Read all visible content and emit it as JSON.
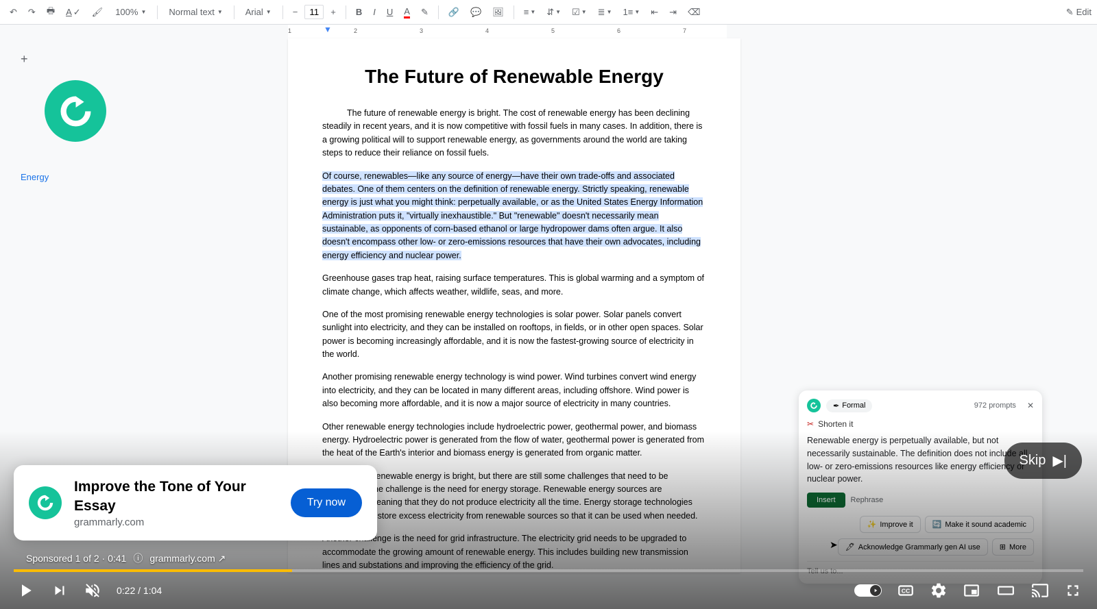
{
  "toolbar": {
    "zoom": "100%",
    "style": "Normal text",
    "font": "Arial",
    "size": "11",
    "edit": "Edit"
  },
  "ruler": {
    "marks": [
      "1",
      "2",
      "3",
      "4",
      "5",
      "6",
      "7"
    ]
  },
  "sidebar": {
    "outline_item": "Energy"
  },
  "doc": {
    "title": "The Future of Renewable Energy",
    "p1": "The future of renewable energy is bright. The cost of renewable energy has been declining steadily in recent years, and it is now competitive with fossil fuels in many cases. In addition, there is a growing political will to support renewable energy, as governments around the world are taking steps to reduce their reliance on fossil fuels.",
    "p2": "Of course, renewables—like any source of energy—have their own trade-offs and associated debates. One of them centers on the definition of renewable energy. Strictly speaking, renewable energy is just what you might think: perpetually available, or as the United States Energy Information Administration puts it, \"virtually inexhaustible.\" But \"renewable\" doesn't necessarily mean sustainable, as opponents of corn-based ethanol or large hydropower dams often argue. It also doesn't encompass other low- or zero-emissions resources that have their own advocates, including energy efficiency and nuclear power.",
    "p3": "Greenhouse gases trap heat, raising surface temperatures. This is global warming and a symptom of climate change, which affects weather, wildlife, seas, and more.",
    "p4": "One of the most promising renewable energy technologies is solar power. Solar panels convert sunlight into electricity, and they can be installed on rooftops, in fields, or in other open spaces. Solar power is becoming increasingly affordable, and it is now the fastest-growing source of electricity in the world.",
    "p5": "Another promising renewable energy technology is wind power. Wind turbines convert wind energy into electricity, and they can be located in many different areas, including offshore. Wind power is also becoming more affordable, and it is now a major source of electricity in many countries.",
    "p6": "Other renewable energy technologies include hydroelectric power, geothermal power, and biomass energy. Hydroelectric power is generated from the flow of water, geothermal power is generated from the heat of the Earth's interior and biomass energy is generated from organic matter.",
    "p7": "The future of renewable energy is bright, but there are still some challenges that need to be addressed. One challenge is the need for energy storage. Renewable energy sources are intermittent, meaning that they do not produce electricity all the time. Energy storage technologies are needed to store excess electricity from renewable sources so that it can be used when needed.",
    "p8": "Another challenge is the need for grid infrastructure. The electricity grid needs to be upgraded to accommodate the growing amount of renewable energy. This includes building new transmission lines and substations and improving the efficiency of the grid."
  },
  "grammarly": {
    "tone": "Formal",
    "prompts": "972 prompts",
    "action": "Shorten it",
    "suggestion": "Renewable energy is perpetually available, but not necessarily sustainable. The definition does not include all low- or zero-emissions resources like energy efficiency or nuclear power.",
    "insert": "Insert",
    "rephrase": "Rephrase",
    "chip_improve": "Improve it",
    "chip_academic": "Make it sound academic",
    "chip_acknowledge": "Acknowledge Grammarly gen AI use",
    "chip_more": "More",
    "placeholder": "Tell us to..."
  },
  "ad": {
    "title": "Improve the Tone of Your Essay",
    "domain": "grammarly.com",
    "cta": "Try now",
    "meta_text": "Sponsored 1 of 2 · 0:41",
    "meta_link": "grammarly.com"
  },
  "skip": "Skip",
  "video": {
    "time": "0:22 / 1:04"
  }
}
